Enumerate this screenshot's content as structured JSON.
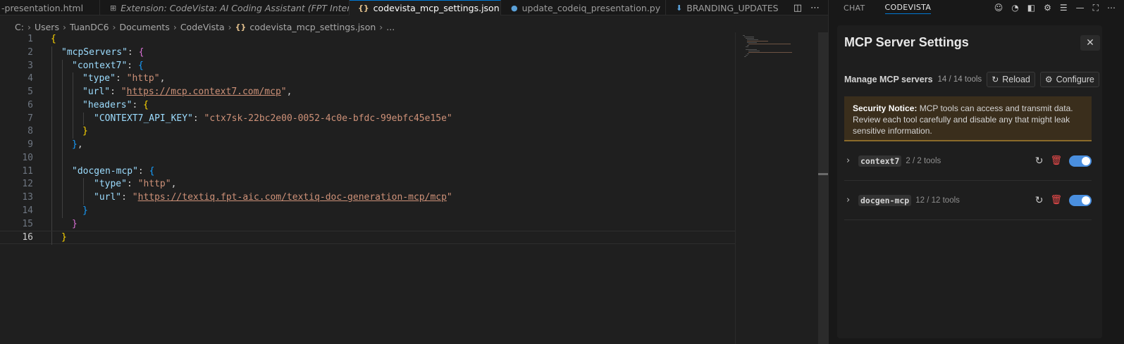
{
  "tabs": [
    {
      "label": "-presentation.html",
      "icon": "html-file-icon",
      "active": false,
      "italic": false
    },
    {
      "label": "Extension: CodeVista: AI Coding Assistant (FPT Internal)",
      "icon": "extension-icon",
      "active": false,
      "italic": true
    },
    {
      "label": "codevista_mcp_settings.json",
      "icon": "json-file-icon",
      "active": true,
      "italic": false
    },
    {
      "label": "update_codeiq_presentation.py",
      "icon": "python-file-icon",
      "active": false,
      "italic": false
    },
    {
      "label": "BRANDING_UPDATES",
      "icon": "markdown-file-icon",
      "active": false,
      "italic": false
    }
  ],
  "breadcrumb": {
    "items": [
      "C:",
      "Users",
      "TuanDC6",
      "Documents",
      "CodeVista",
      "codevista_mcp_settings.json",
      "..."
    ],
    "file_icon": "{}"
  },
  "editor": {
    "line_numbers": [
      "1",
      "2",
      "3",
      "4",
      "5",
      "6",
      "7",
      "8",
      "9",
      "10",
      "11",
      "12",
      "13",
      "14",
      "15",
      "16"
    ],
    "current_line": "16",
    "tokens": {
      "l1_open": "{",
      "l2_key": "\"mcpServers\"",
      "l2_colon": ": ",
      "l2_open": "{",
      "l3_key": "\"context7\"",
      "l3_colon": ": ",
      "l3_open": "{",
      "l4_key": "\"type\"",
      "l4_colon": ": ",
      "l4_val": "\"http\"",
      "l4_comma": ",",
      "l5_key": "\"url\"",
      "l5_colon": ": ",
      "l5_q1": "\"",
      "l5_val": "https://mcp.context7.com/mcp",
      "l5_q2": "\"",
      "l5_comma": ",",
      "l6_key": "\"headers\"",
      "l6_colon": ": ",
      "l6_open": "{",
      "l7_key": "\"CONTEXT7_API_KEY\"",
      "l7_colon": ": ",
      "l7_val": "\"ctx7sk-22bc2e00-0052-4c0e-bfdc-99ebfc45e15e\"",
      "l8_close": "}",
      "l9_close": "}",
      "l9_comma": ",",
      "l11_key": "\"docgen-mcp\"",
      "l11_colon": ": ",
      "l11_open": "{",
      "l12_key": "\"type\"",
      "l12_colon": ": ",
      "l12_val": "\"http\"",
      "l12_comma": ",",
      "l13_key": "\"url\"",
      "l13_colon": ": ",
      "l13_q1": "\"",
      "l13_val": "https://textiq.fpt-aic.com/textiq-doc-generation-mcp/mcp",
      "l13_q2": "\"",
      "l14_close": "}",
      "l15_close": "}",
      "l16_close": "}"
    }
  },
  "panel": {
    "tabs": [
      "CHAT",
      "CODEVISTA"
    ],
    "active_tab": "CODEVISTA",
    "title": "MCP Server Settings",
    "close_glyph": "✕",
    "manage_label": "Manage MCP servers",
    "tool_count": "14 / 14 tools",
    "reload_label": "Reload",
    "configure_label": "Configure",
    "notice_bold": "Security Notice:",
    "notice_text": " MCP tools can access and transmit data. Review each tool carefully and disable any that might leak sensitive information.",
    "servers": [
      {
        "name": "context7",
        "count": "2 / 2 tools",
        "enabled": true
      },
      {
        "name": "docgen-mcp",
        "count": "12 / 12 tools",
        "enabled": true
      }
    ]
  },
  "colors": {
    "accent": "#0078d4",
    "toggle_on": "#4a8fdf",
    "delete": "#f14c4c",
    "notice_bg": "#3a2e1c"
  }
}
